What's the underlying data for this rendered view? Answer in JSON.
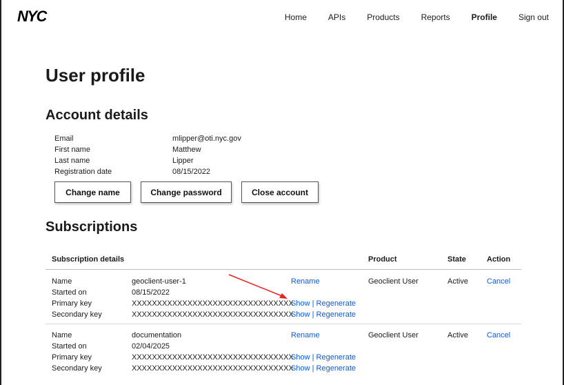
{
  "header": {
    "logo": "NYC",
    "nav": [
      "Home",
      "APIs",
      "Products",
      "Reports",
      "Profile",
      "Sign out"
    ],
    "active": "Profile"
  },
  "page_title": "User profile",
  "account": {
    "heading": "Account details",
    "fields": [
      {
        "label": "Email",
        "value": "mlipper@oti.nyc.gov"
      },
      {
        "label": "First name",
        "value": "Matthew"
      },
      {
        "label": "Last name",
        "value": "Lipper"
      },
      {
        "label": "Registration date",
        "value": "08/15/2022"
      }
    ],
    "buttons": [
      "Change name",
      "Change password",
      "Close account"
    ]
  },
  "subscriptions": {
    "heading": "Subscriptions",
    "columns": [
      "Subscription details",
      "Product",
      "State",
      "Action"
    ],
    "row_labels": [
      "Name",
      "Started on",
      "Primary key",
      "Secondary key"
    ],
    "rename_label": "Rename",
    "show_label": "Show",
    "separator": "|",
    "regenerate_label": "Regenerate",
    "rows": [
      {
        "name": "geoclient-user-1",
        "started_on": "08/15/2022",
        "primary_key": "XXXXXXXXXXXXXXXXXXXXXXXXXXXXXXXX",
        "secondary_key": "XXXXXXXXXXXXXXXXXXXXXXXXXXXXXXXX",
        "product": "Geoclient User",
        "state": "Active",
        "action": "Cancel"
      },
      {
        "name": "documentation",
        "started_on": "02/04/2025",
        "primary_key": "XXXXXXXXXXXXXXXXXXXXXXXXXXXXXXXX",
        "secondary_key": "XXXXXXXXXXXXXXXXXXXXXXXXXXXXXXXX",
        "product": "Geoclient User",
        "state": "Active",
        "action": "Cancel"
      }
    ]
  },
  "colors": {
    "link": "#0a5bd6",
    "annotation_arrow": "#e8231f"
  }
}
